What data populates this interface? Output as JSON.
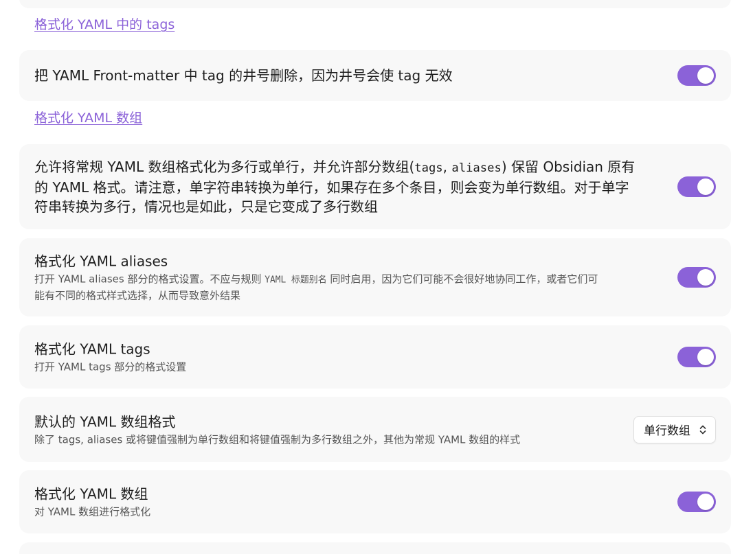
{
  "theme": {
    "accent": "#8b62d8",
    "card_background": "#f8f8f8",
    "background": "#ffffff"
  },
  "sections": {
    "tags_heading": "格式化 YAML 中的 tags",
    "array_heading": "格式化 YAML 数组"
  },
  "settings": {
    "remove_hashtags": {
      "title": "把 YAML Front-matter 中 tag 的井号删除，因为井号会使 tag 无效",
      "enabled": true
    },
    "format_arrays_multiline": {
      "line1_a": "允许将常规 YAML 数组格式化为多行或单行，并允许部分数组(",
      "code_tags": "tags",
      "comma": ", ",
      "code_aliases": "aliases",
      "line1_b": ") 保留 Obsidian 原有",
      "line2": "的 YAML 格式。请注意，单字符串转换为单行，如果存在多个条目，则会变为单行数组。对于单字",
      "line3": "符串转换为多行，情况也是如此，只是它变成了多行数组",
      "enabled": true
    },
    "format_aliases": {
      "title": "格式化 YAML aliases",
      "desc_a": "打开 YAML aliases 部分的格式设置。不应与规则 ",
      "desc_code": "YAML 标题别名",
      "desc_b": " 同时启用，因为它们可能不会很好地协同工作，或者它们可",
      "desc_line2": "能有不同的格式样式选择，从而导致意外结果",
      "enabled": true
    },
    "format_tags": {
      "title": "格式化 YAML tags",
      "desc": "打开 YAML tags 部分的格式设置",
      "enabled": true
    },
    "default_array_style": {
      "title": "默认的 YAML 数组格式",
      "desc": "除了 tags, aliases 或将键值强制为单行数组和将键值强制为多行数组之外，其他为常规 YAML 数组的样式",
      "selected": "单行数组",
      "icon": "chevron-up-down-icon"
    },
    "format_arrays": {
      "title": "格式化 YAML 数组",
      "desc": "对 YAML 数组进行格式化",
      "enabled": true
    }
  }
}
